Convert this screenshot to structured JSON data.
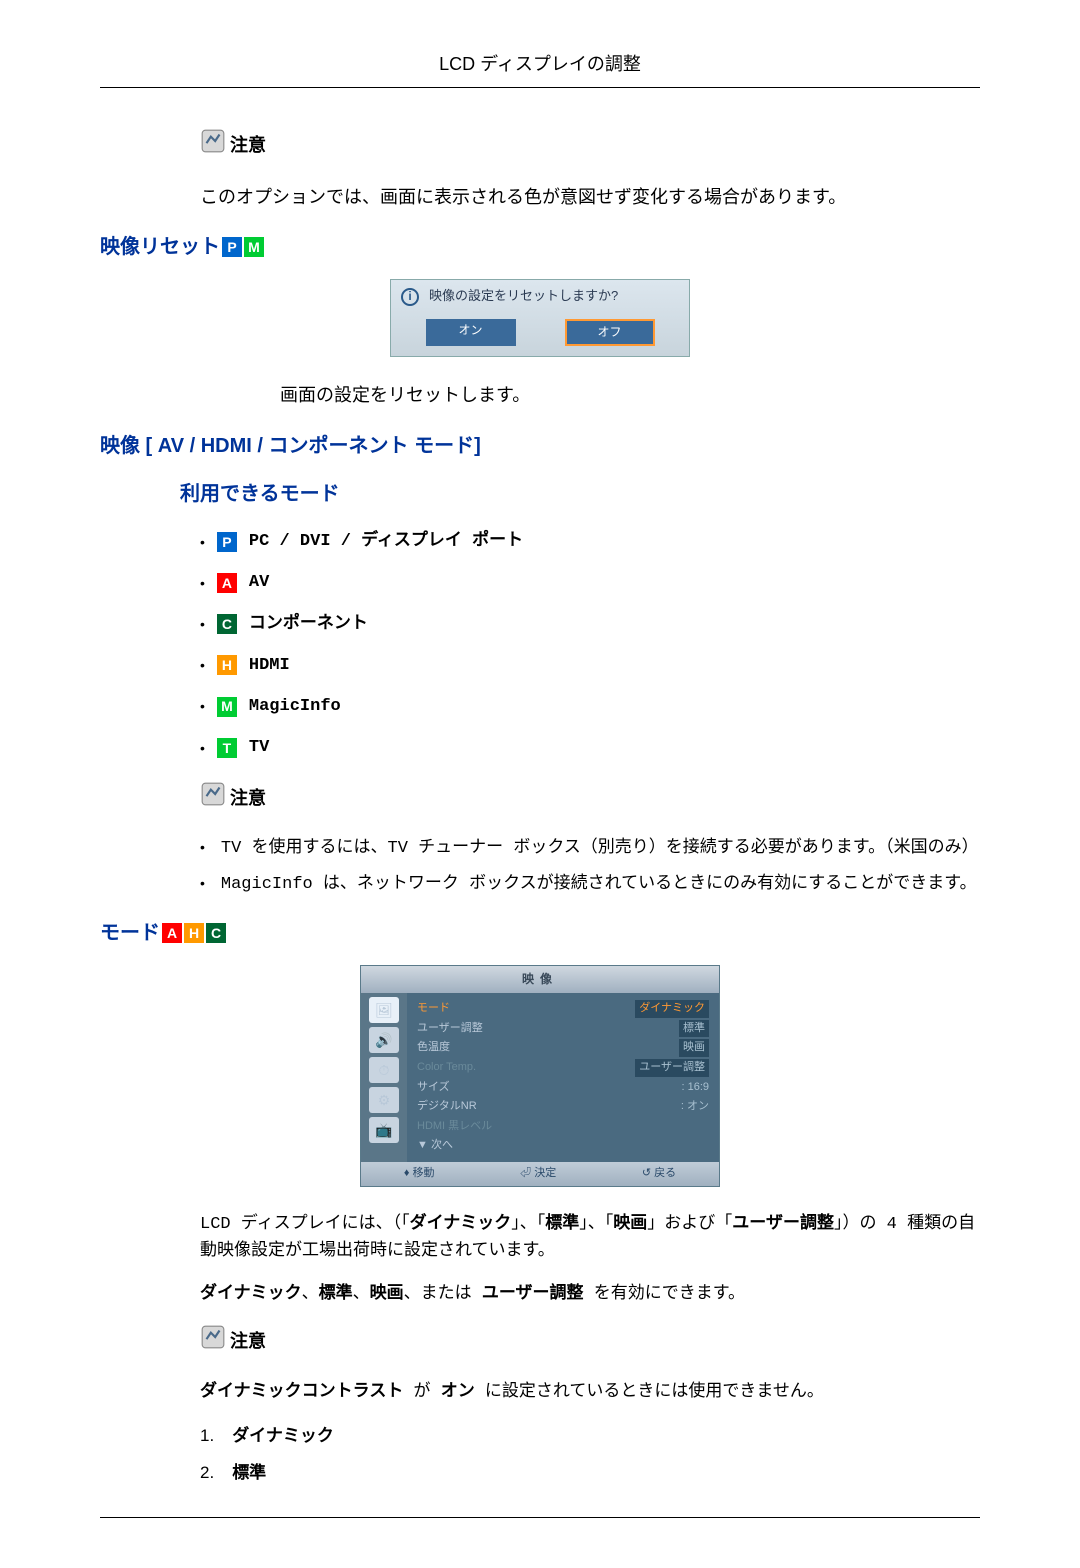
{
  "header": {
    "title": "LCD ディスプレイの調整"
  },
  "note_label": "注意",
  "note1": "このオプションでは、画面に表示される色が意図せず変化する場合があります。",
  "sec_reset": {
    "title": "映像リセット"
  },
  "reset_dialog": {
    "prompt": "映像の設定をリセットしますか?",
    "on": "オン",
    "off": "オフ"
  },
  "reset_desc": "画面の設定をリセットします。",
  "sec_picture": {
    "title": "映像 [ AV / HDMI / コンポーネント モード]"
  },
  "avail_heading": "利用できるモード",
  "modes": {
    "p": "PC / DVI / ディスプレイ ポート",
    "a": "AV",
    "c": "コンポーネント",
    "h": "HDMI",
    "m": "MagicInfo",
    "t": "TV"
  },
  "avail_notes": [
    "TV を使用するには、TV チューナー ボックス（別売り）を接続する必要があります。（米国のみ）",
    "MagicInfo は、ネットワーク ボックスが接続されているときにのみ有効にすることができます。"
  ],
  "sec_mode": {
    "title": "モード"
  },
  "osd": {
    "tab": "映像",
    "rows": {
      "mode": "モード",
      "user": "ユーザー調整",
      "colortemp_jp": "色温度",
      "colortemp_en": "Color Temp.",
      "size": "サイズ",
      "dnr": "デジタルNR",
      "hdmi": "HDMI 黒レベル",
      "next": "▼ 次へ"
    },
    "vals": {
      "mode": "ダイナミック",
      "opt_std": "標準",
      "opt_movie": "映画",
      "opt_user": "ユーザー調整",
      "size": ": 16:9",
      "dnr": ": オン"
    },
    "footer": {
      "move": "移動",
      "enter": "決定",
      "return": "戻る"
    }
  },
  "mode_para": {
    "p1a": "LCD ディスプレイには、（「",
    "d": "ダイナミック",
    "p1b": "」、「",
    "s": "標準",
    "p1c": "」、「",
    "m": "映画",
    "p1d": "」および「",
    "u": "ユーザー調整",
    "p1e": "」）の 4 種類の自動映像設定が工場出荷時に設定されています。",
    "p2a": "ダイナミック",
    "p2b": "、",
    "p2c": "標準",
    "p2d": "、",
    "p2e": "映画",
    "p2f": "、または ",
    "p2g": "ユーザー調整",
    "p2h": " を有効にできます。"
  },
  "note3": {
    "a": "ダイナミックコントラスト",
    "b": " が ",
    "c": "オン",
    "d": " に設定されているときには使用できません。"
  },
  "ol": {
    "i1": "ダイナミック",
    "i2": "標準"
  }
}
